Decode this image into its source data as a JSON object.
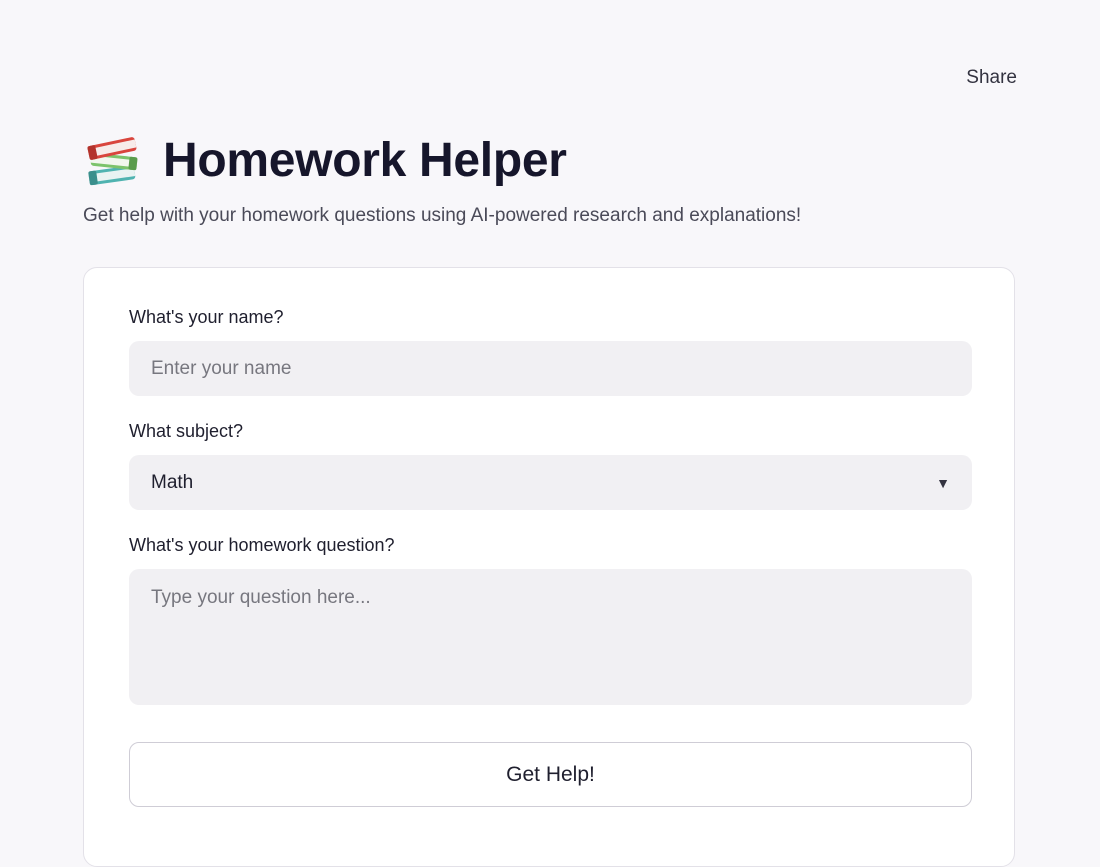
{
  "header": {
    "share_label": "Share",
    "icon": "books-icon",
    "title": "Homework Helper",
    "subtitle": "Get help with your homework questions using AI-powered research and explanations!"
  },
  "form": {
    "name_label": "What's your name?",
    "name_value": "",
    "name_placeholder": "Enter your name",
    "subject_label": "What subject?",
    "subject_selected": "Math",
    "question_label": "What's your homework question?",
    "question_value": "",
    "question_placeholder": "Type your question here...",
    "submit_label": "Get Help!"
  },
  "colors": {
    "background": "#f8f7fa",
    "card": "#ffffff",
    "input_bg": "#f1f0f3",
    "title": "#16162b"
  }
}
